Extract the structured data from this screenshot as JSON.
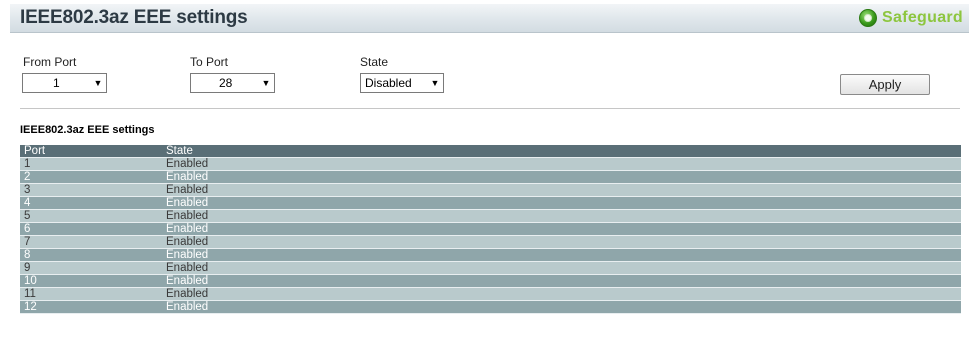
{
  "header": {
    "title": "IEEE802.3az EEE settings",
    "brand": "Safeguard",
    "brand_color": "#8dc63f"
  },
  "form": {
    "from_port": {
      "label": "From Port",
      "value": "1"
    },
    "to_port": {
      "label": "To Port",
      "value": "28"
    },
    "state": {
      "label": "State",
      "value": "Disabled"
    },
    "apply_label": "Apply"
  },
  "table": {
    "section_title": "IEEE802.3az EEE settings",
    "columns": [
      "Port",
      "State"
    ],
    "rows": [
      {
        "port": "1",
        "state": "Enabled"
      },
      {
        "port": "2",
        "state": "Enabled"
      },
      {
        "port": "3",
        "state": "Enabled"
      },
      {
        "port": "4",
        "state": "Enabled"
      },
      {
        "port": "5",
        "state": "Enabled"
      },
      {
        "port": "6",
        "state": "Enabled"
      },
      {
        "port": "7",
        "state": "Enabled"
      },
      {
        "port": "8",
        "state": "Enabled"
      },
      {
        "port": "9",
        "state": "Enabled"
      },
      {
        "port": "10",
        "state": "Enabled"
      },
      {
        "port": "11",
        "state": "Enabled"
      },
      {
        "port": "12",
        "state": "Enabled"
      }
    ]
  }
}
